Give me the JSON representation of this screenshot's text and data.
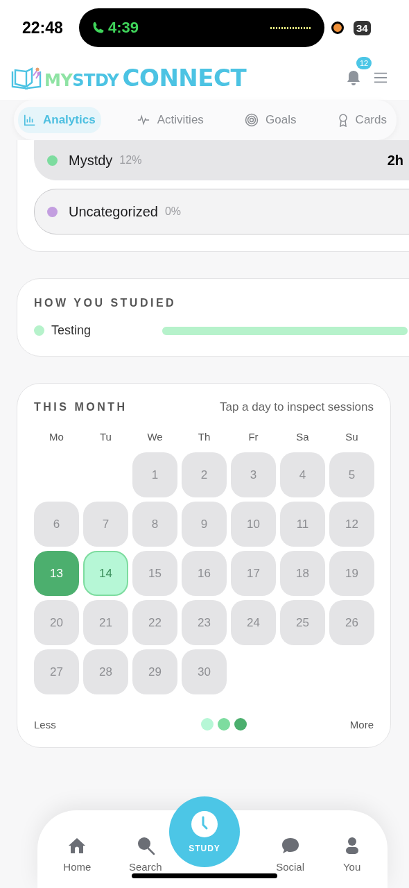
{
  "status_bar": {
    "time": "22:48",
    "call_time": "4:39",
    "battery": "34"
  },
  "header": {
    "logo": {
      "first": "MY",
      "second": "STDY",
      "third": "CONNECT"
    },
    "notification_count": "12"
  },
  "tabs": [
    {
      "label": "Analytics",
      "selected": true
    },
    {
      "label": "Activities",
      "selected": false
    },
    {
      "label": "Goals",
      "selected": false
    },
    {
      "label": "Cards",
      "selected": false
    }
  ],
  "categories": [
    {
      "name": "Mystdy",
      "percent": "12%",
      "time": "2h",
      "color": "#7ddc9f",
      "selected": true
    },
    {
      "name": "Uncategorized",
      "percent": "0%",
      "color": "#c39ee0",
      "selected": false
    }
  ],
  "how_you_studied": {
    "title": "HOW YOU STUDIED",
    "items": [
      {
        "name": "Testing",
        "color": "#b6f2cb",
        "level": 1
      }
    ]
  },
  "month": {
    "title": "THIS MONTH",
    "hint": "Tap a day to inspect sessions",
    "weekdays": [
      "Mo",
      "Tu",
      "We",
      "Th",
      "Fr",
      "Sa",
      "Su"
    ],
    "weeks": [
      [
        {
          "kind": "blank"
        },
        {
          "kind": "blank"
        },
        {
          "kind": "empty",
          "day": "1",
          "selected": false
        },
        {
          "kind": "empty",
          "day": "2",
          "selected": false
        },
        {
          "kind": "empty",
          "day": "3",
          "selected": false
        },
        {
          "kind": "empty",
          "day": "4",
          "selected": false
        },
        {
          "kind": "empty",
          "day": "5",
          "selected": false
        }
      ],
      [
        {
          "kind": "empty",
          "day": "6",
          "selected": false
        },
        {
          "kind": "empty",
          "day": "7",
          "selected": false
        },
        {
          "kind": "empty",
          "day": "8",
          "selected": false
        },
        {
          "kind": "empty",
          "day": "9",
          "selected": false
        },
        {
          "kind": "empty",
          "day": "10",
          "selected": false
        },
        {
          "kind": "empty",
          "day": "11",
          "selected": false
        },
        {
          "kind": "empty",
          "day": "12",
          "selected": false
        }
      ],
      [
        {
          "kind": "high",
          "day": "13",
          "selected": false
        },
        {
          "kind": "low",
          "day": "14",
          "selected": true
        },
        {
          "kind": "empty",
          "day": "15",
          "selected": false
        },
        {
          "kind": "empty",
          "day": "16",
          "selected": false
        },
        {
          "kind": "empty",
          "day": "17",
          "selected": false
        },
        {
          "kind": "empty",
          "day": "18",
          "selected": false
        },
        {
          "kind": "empty",
          "day": "19",
          "selected": false
        }
      ],
      [
        {
          "kind": "empty",
          "day": "20",
          "selected": false
        },
        {
          "kind": "empty",
          "day": "21",
          "selected": false
        },
        {
          "kind": "empty",
          "day": "22",
          "selected": false
        },
        {
          "kind": "empty",
          "day": "23",
          "selected": false
        },
        {
          "kind": "empty",
          "day": "24",
          "selected": false
        },
        {
          "kind": "empty",
          "day": "25",
          "selected": false
        },
        {
          "kind": "empty",
          "day": "26",
          "selected": false
        }
      ],
      [
        {
          "kind": "empty",
          "day": "27",
          "selected": false
        },
        {
          "kind": "empty",
          "day": "28",
          "selected": false
        },
        {
          "kind": "empty",
          "day": "29",
          "selected": false
        },
        {
          "kind": "empty",
          "day": "30",
          "selected": false
        }
      ]
    ],
    "legend": {
      "less": "Less",
      "more": "More",
      "swatches": [
        {
          "color": "#b6f7d6"
        },
        {
          "color": "#7ddc9f"
        },
        {
          "color": "#4caf6e"
        }
      ]
    }
  },
  "bottom_nav": [
    {
      "label": "Home",
      "kind": "tab"
    },
    {
      "label": "Search",
      "kind": "tab"
    },
    {
      "label": "STUDY",
      "kind": "main"
    },
    {
      "label": "Social",
      "kind": "tab"
    },
    {
      "label": "You",
      "kind": "tab"
    }
  ]
}
